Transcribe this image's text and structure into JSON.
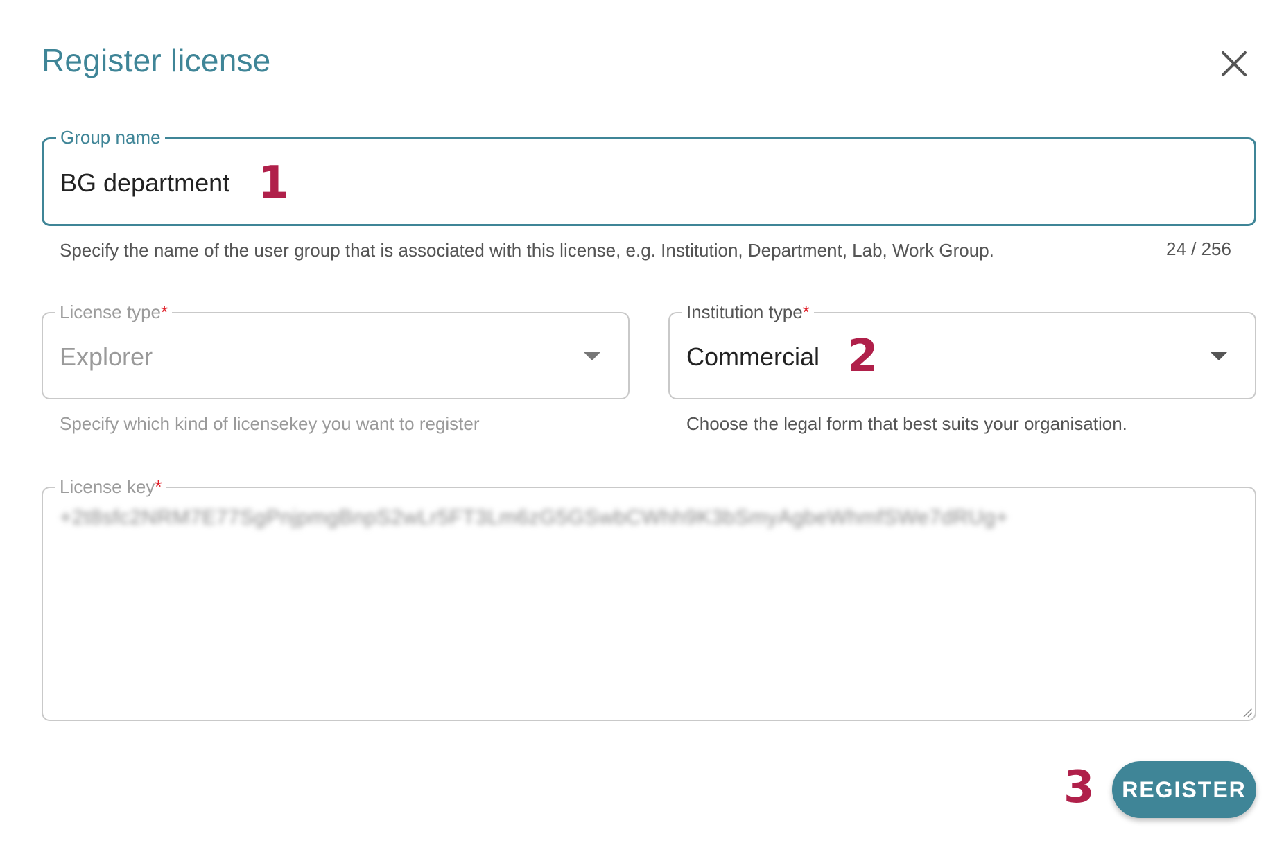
{
  "dialog": {
    "title": "Register license"
  },
  "group_name": {
    "label": "Group name",
    "value": "BG department",
    "helper": "Specify the name of the user group that is associated with this license, e.g. Institution, Department, Lab, Work Group.",
    "counter": "24 / 256"
  },
  "license_type": {
    "label": "License type",
    "required_mark": "*",
    "value": "Explorer",
    "helper": "Specify which kind of licensekey you want to register"
  },
  "institution_type": {
    "label": "Institution type",
    "required_mark": "*",
    "value": "Commercial",
    "helper": "Choose the legal form that best suits your organisation."
  },
  "license_key": {
    "label": "License key",
    "required_mark": "*",
    "value": "+2t8sfc2NRM7E77SgPnjpmgBnpS2wLr5FT3Lm6zG5GSwbCWhh9K3bSmyAgbeWhmfSWe7dRUg+"
  },
  "annotations": [
    "1",
    "2",
    "3"
  ],
  "register_button": {
    "label": "REGISTER"
  },
  "colors": {
    "accent": "#3f8597",
    "required": "#e0202a",
    "annotation": "#b0204a"
  }
}
